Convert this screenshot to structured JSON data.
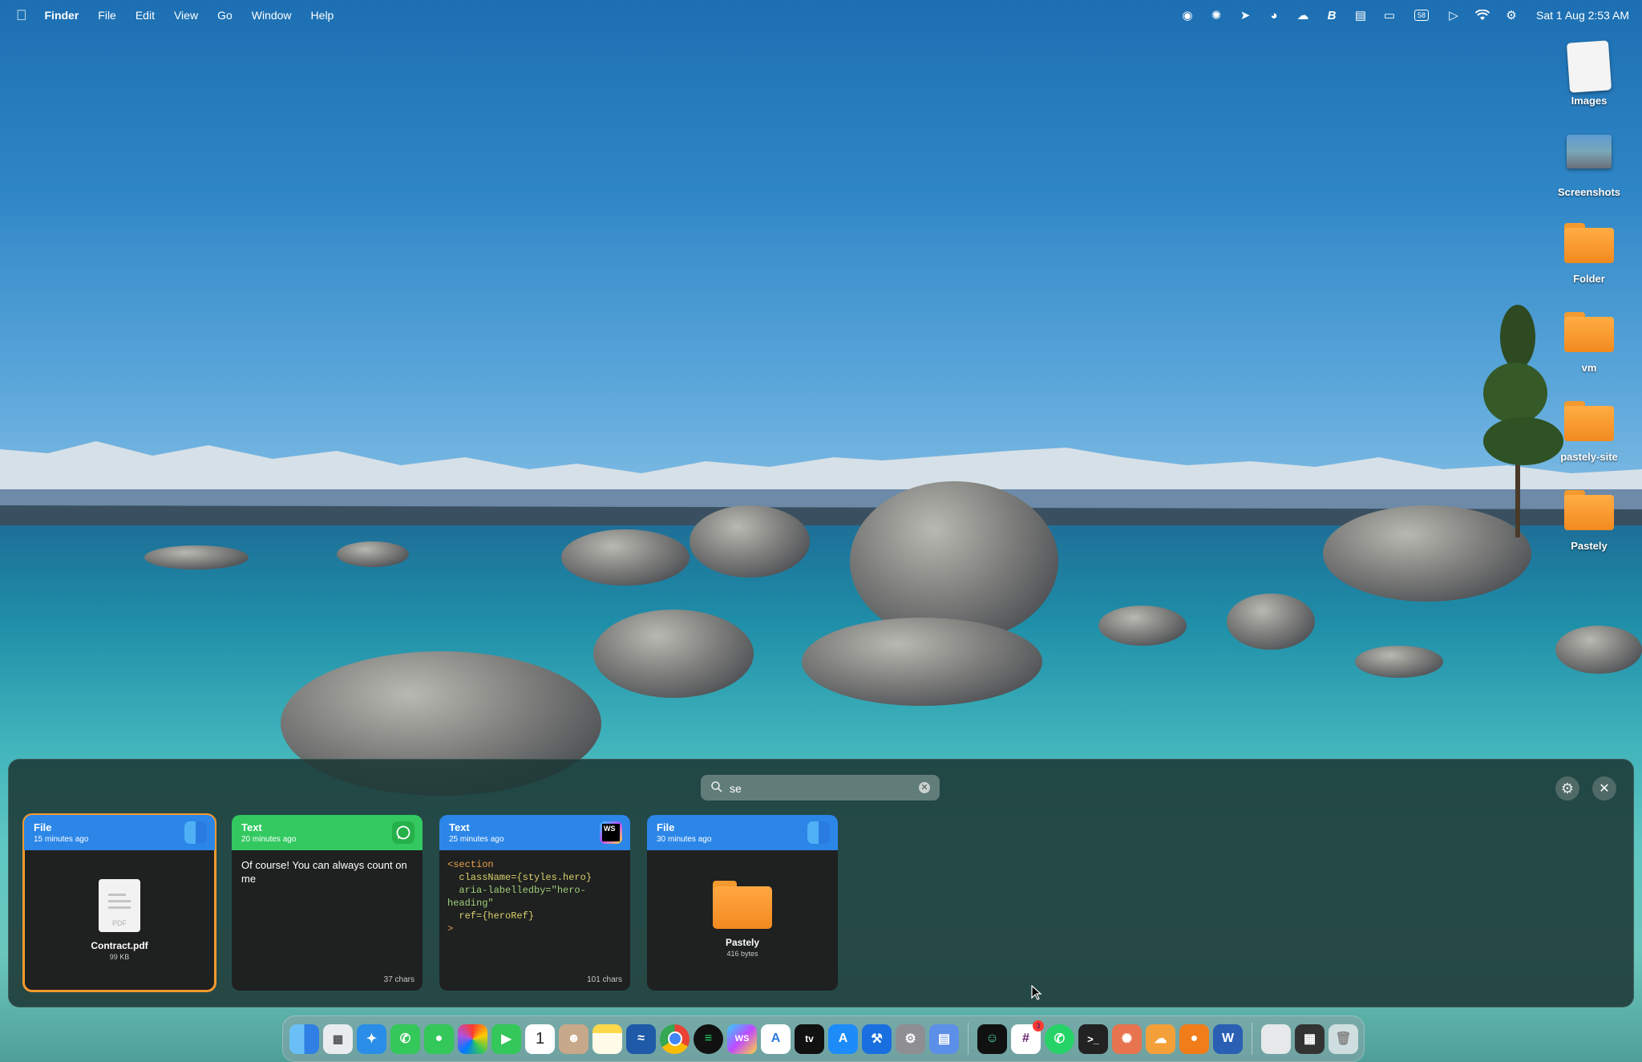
{
  "menubar": {
    "app_name": "Finder",
    "menus": [
      "File",
      "Edit",
      "View",
      "Go",
      "Window",
      "Help"
    ],
    "status_icons": [
      "headset-icon",
      "sparkle-icon",
      "location-icon",
      "arc-icon",
      "cloud-icon",
      "bluetooth-b-icon",
      "display-icon",
      "screen-mirror-icon",
      "battery-icon",
      "play-icon",
      "wifi-icon",
      "control-center-icon"
    ],
    "battery_text": "58",
    "clock": "Sat 1 Aug  2:53 AM"
  },
  "desktop": {
    "items": [
      {
        "label": "Images",
        "kind": "document"
      },
      {
        "label": "Screenshots",
        "kind": "screenshot"
      },
      {
        "label": "Folder",
        "kind": "folder"
      },
      {
        "label": "vm",
        "kind": "folder"
      },
      {
        "label": "pastely-site",
        "kind": "folder"
      },
      {
        "label": "Pastely",
        "kind": "folder"
      }
    ]
  },
  "panel": {
    "search": {
      "value": "se",
      "placeholder": ""
    },
    "cards": [
      {
        "type": "File",
        "time": "15 minutes ago",
        "app": "finder-icon",
        "header_color": "#2b86e8",
        "file_name": "Contract.pdf",
        "file_size": "99 KB",
        "selected": true
      },
      {
        "type": "Text",
        "time": "20 minutes ago",
        "app": "whatsapp-icon",
        "header_color": "#33c960",
        "text": "Of course! You can always count on me",
        "footer": "37 chars"
      },
      {
        "type": "Text",
        "time": "25 minutes ago",
        "app": "webstorm-icon",
        "header_color": "#2b86e8",
        "code_lines": [
          "<section",
          "  className={styles.hero}",
          "  aria-labelledby=\"hero-",
          "heading\"",
          "  ref={heroRef}",
          ">"
        ],
        "footer": "101 chars"
      },
      {
        "type": "File",
        "time": "30 minutes ago",
        "app": "finder-icon",
        "header_color": "#2b86e8",
        "file_name": "Pastely",
        "file_size": "416 bytes"
      }
    ]
  },
  "dock": {
    "apps": [
      "finder",
      "launchpad",
      "safari",
      "phone",
      "messages",
      "photos",
      "facetime",
      "calendar",
      "contacts",
      "notes",
      "freeform",
      "chrome",
      "spotify",
      "webstorm",
      "textedit",
      "appletv",
      "appstore",
      "xcode",
      "system-settings",
      "preview",
      "chatgpt",
      "slack",
      "whatsapp",
      "terminal",
      "claude",
      "cloud",
      "pastely",
      "word",
      "downloads",
      "window-manager",
      "trash"
    ],
    "calendar_day": "1",
    "slack_badge": "3"
  }
}
